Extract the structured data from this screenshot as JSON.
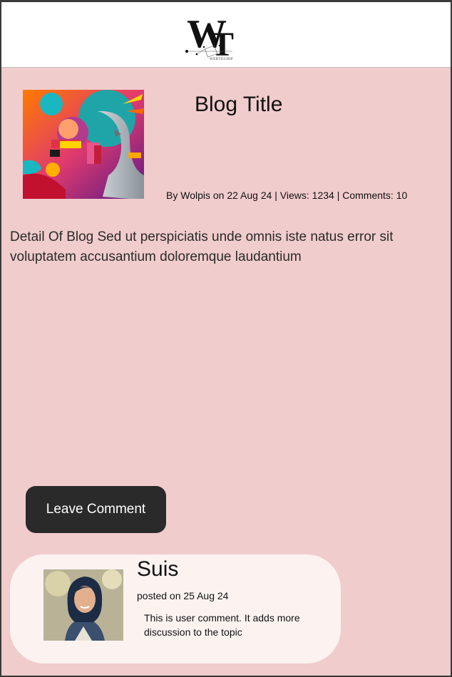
{
  "header": {
    "logo_icon": "webtechip-logo-icon",
    "logo_sub": "WEBTECHIP"
  },
  "post": {
    "image_icon": "abstract-art-image",
    "title": "Blog Title",
    "meta": "By Wolpis on 22 Aug 24 | Views: 1234 | Comments: 10",
    "detail": "Detail Of Blog Sed ut perspiciatis unde omnis iste natus error sit voluptatem accusantium doloremque laudantium"
  },
  "actions": {
    "leave_comment_label": "Leave Comment"
  },
  "comment": {
    "avatar_icon": "user-avatar-photo",
    "user": "Suis",
    "posted": "posted on 25 Aug 24",
    "text": "This is user comment. It adds more discussion to the topic"
  },
  "colors": {
    "page_bg": "#f1cccc",
    "header_bg": "#ffffff",
    "button_bg": "#2a2a2a",
    "card_bg": "#fcf3f1"
  }
}
